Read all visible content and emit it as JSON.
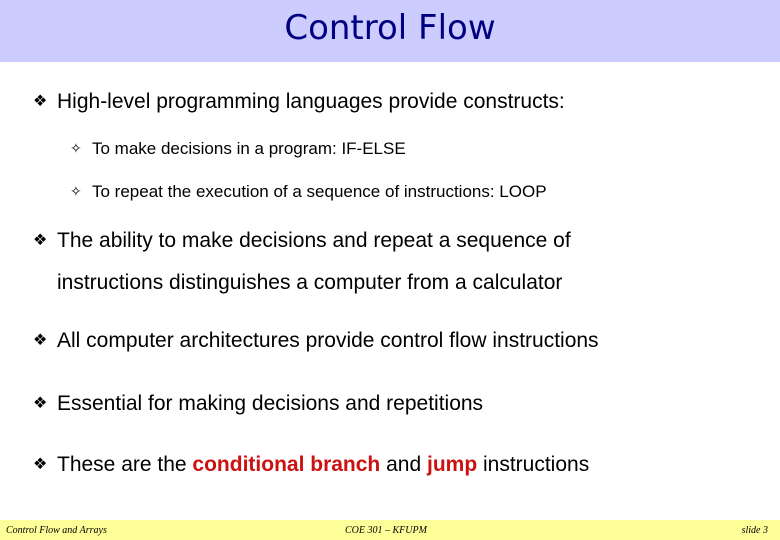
{
  "title": "Control Flow",
  "bullets": [
    {
      "text": "High-level programming languages provide constructs:"
    },
    {
      "text": "To make decisions in a program: IF-ELSE"
    },
    {
      "text": "To repeat the execution of a sequence of instructions: LOOP"
    },
    {
      "text": "The ability to make decisions and repeat a sequence of",
      "cont": "instructions distinguishes a computer from a calculator"
    },
    {
      "text": "All computer architectures provide control flow instructions"
    },
    {
      "text": "Essential for making decisions and repetitions"
    },
    {
      "pre": "These are the ",
      "hl1": "conditional branch",
      "mid": " and ",
      "hl2": "jump",
      "post": " instructions"
    }
  ],
  "icons": {
    "level1": "❖",
    "level2": "✧"
  },
  "footer": {
    "left": "Control Flow and Arrays",
    "center": "COE 301 – KFUPM",
    "right": "slide 3"
  }
}
